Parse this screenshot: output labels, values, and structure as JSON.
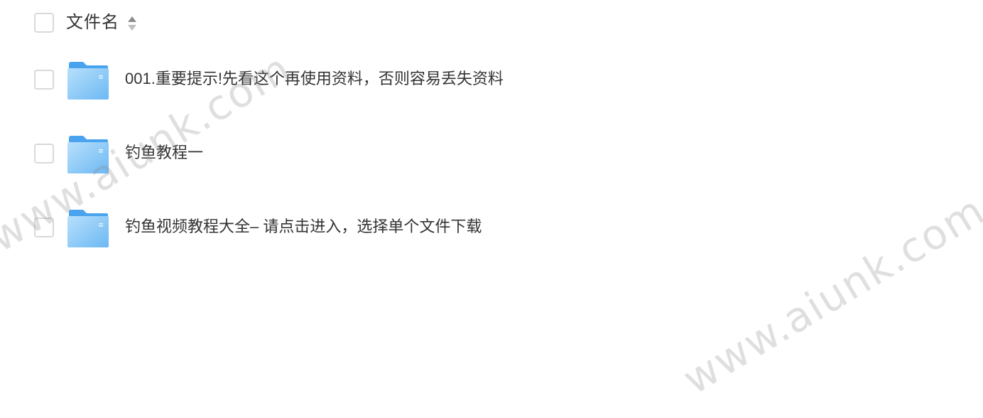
{
  "header": {
    "column_label": "文件名"
  },
  "files": [
    {
      "name": "001.重要提示!先看这个再使用资料，否则容易丢失资料",
      "type": "folder"
    },
    {
      "name": "钓鱼教程一",
      "type": "folder"
    },
    {
      "name": "钓鱼视频教程大全– 请点击进入，选择单个文件下载",
      "type": "folder"
    }
  ],
  "watermark": "www.aiunk.com",
  "colors": {
    "folder_light": "#9dd1f7",
    "folder_dark": "#4aa3ee",
    "checkbox_border": "#d9d9d9",
    "text": "#333333"
  }
}
